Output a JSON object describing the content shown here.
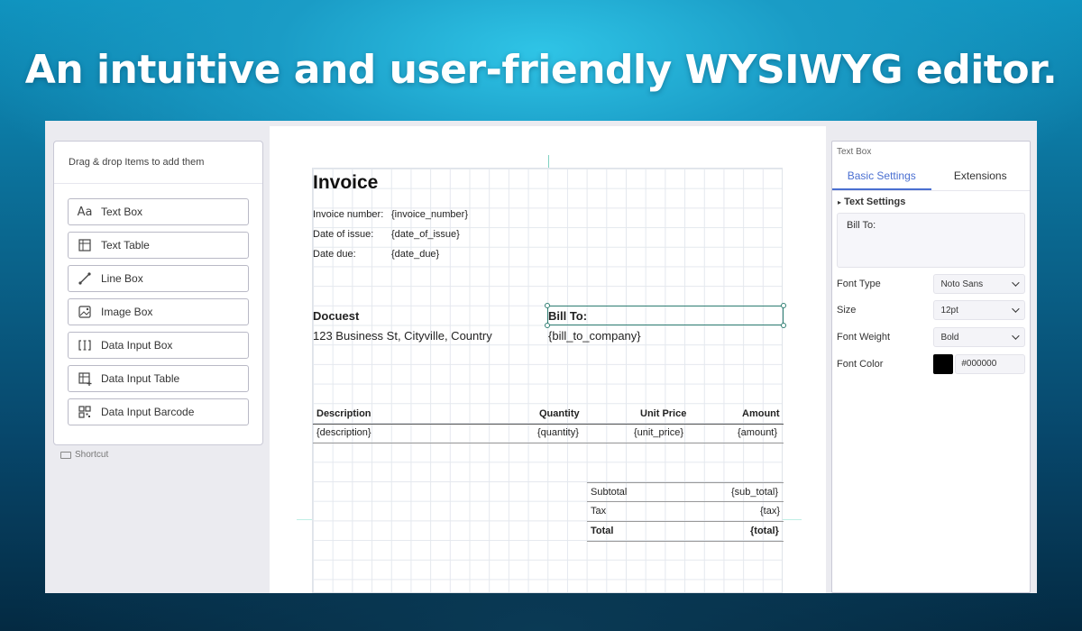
{
  "headline": "An intuitive and user-friendly WYSIWYG editor.",
  "palette": {
    "hint": "Drag & drop Items to add them",
    "tools": [
      {
        "label": "Text Box",
        "icon": "text-box-icon"
      },
      {
        "label": "Text Table",
        "icon": "table-icon"
      },
      {
        "label": "Line Box",
        "icon": "line-icon"
      },
      {
        "label": "Image Box",
        "icon": "image-icon"
      },
      {
        "label": "Data Input Box",
        "icon": "data-input-icon"
      },
      {
        "label": "Data Input Table",
        "icon": "data-table-icon"
      },
      {
        "label": "Data Input Barcode",
        "icon": "barcode-icon"
      }
    ],
    "shortcut": "Shortcut"
  },
  "invoice": {
    "title": "Invoice",
    "meta": [
      {
        "label": "Invoice number:",
        "value": "{invoice_number}"
      },
      {
        "label": "Date of issue:",
        "value": "{date_of_issue}"
      },
      {
        "label": "Date due:",
        "value": "{date_due}"
      }
    ],
    "from_name": "Docuest",
    "from_address": "123 Business St, Cityville, Country",
    "bill_to_label": "Bill To:",
    "bill_to_company": "{bill_to_company}",
    "table_headers": [
      "Description",
      "Quantity",
      "Unit Price",
      "Amount"
    ],
    "table_row": [
      "{description}",
      "{quantity}",
      "{unit_price}",
      "{amount}"
    ],
    "totals": [
      {
        "label": "Subtotal",
        "value": "{sub_total}"
      },
      {
        "label": "Tax",
        "value": "{tax}"
      },
      {
        "label": "Total",
        "value": "{total}"
      }
    ]
  },
  "props": {
    "title": "Text Box",
    "tabs": [
      "Basic Settings",
      "Extensions"
    ],
    "section": "Text Settings",
    "text_value": "Bill To:",
    "font_type_label": "Font Type",
    "font_type_value": "Noto Sans",
    "size_label": "Size",
    "size_value": "12pt",
    "weight_label": "Font Weight",
    "weight_value": "Bold",
    "color_label": "Font Color",
    "color_value": "#000000"
  },
  "colors": {
    "accent": "#4a6fd1",
    "selection": "#2f7f73"
  }
}
